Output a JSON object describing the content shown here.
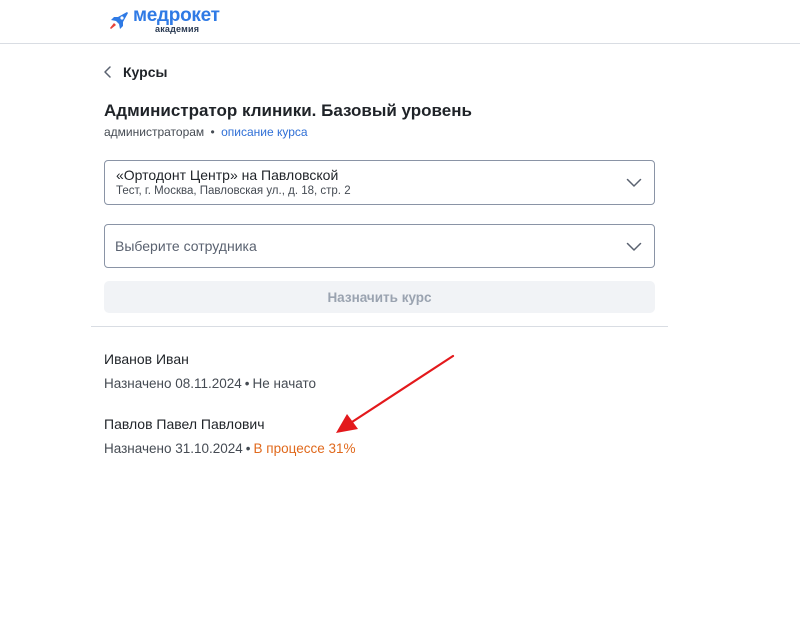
{
  "header": {
    "logo_name": "медрокет",
    "logo_sub": "академия",
    "brand_color": "#2f7ae5",
    "accent_color": "#e8433a"
  },
  "nav": {
    "back_label": "Курсы",
    "back_icon": "chevron-left-icon"
  },
  "course": {
    "title": "Администратор клиники. Базовый уровень",
    "audience": "администраторам",
    "separator": "•",
    "description_link": "описание курса"
  },
  "clinic_select": {
    "value": "«Ортодонт Центр» на Павловской",
    "address": "Тест, г. Москва, Павловская ул., д. 18, стр. 2",
    "icon": "chevron-down-icon"
  },
  "employee_select": {
    "placeholder": "Выберите сотрудника",
    "icon": "chevron-down-icon"
  },
  "assign_button": {
    "label": "Назначить курс",
    "disabled": true
  },
  "assignments": [
    {
      "name": "Иванов Иван",
      "assigned": "Назначено 08.11.2024",
      "status": "Не начато",
      "status_color": "#454b53"
    },
    {
      "name": "Павлов Павел Павлович",
      "assigned": "Назначено 31.10.2024",
      "status": "В процессе 31%",
      "status_color": "#e0691c"
    }
  ],
  "annotation": {
    "type": "arrow",
    "color": "#e3191c"
  }
}
